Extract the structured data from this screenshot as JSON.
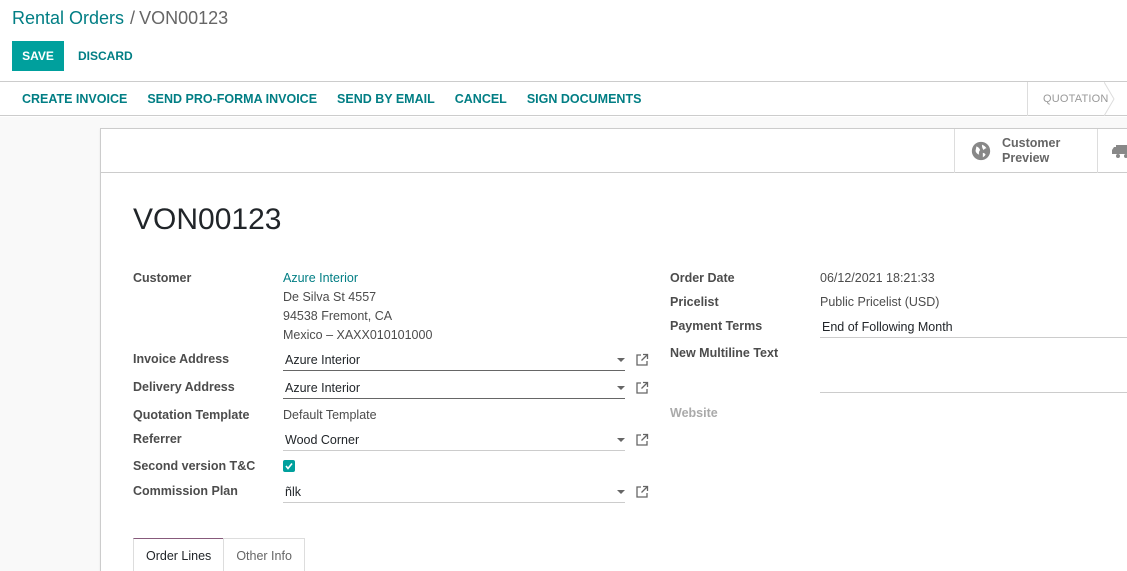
{
  "breadcrumb": {
    "parent": "Rental Orders",
    "separator": "/",
    "current": "VON00123"
  },
  "actions": {
    "save": "SAVE",
    "discard": "DISCARD"
  },
  "statusbar": {
    "buttons": [
      "CREATE INVOICE",
      "SEND PRO-FORMA INVOICE",
      "SEND BY EMAIL",
      "CANCEL",
      "SIGN DOCUMENTS"
    ],
    "stage": "QUOTATION"
  },
  "buttonbox": {
    "customer_preview": "Customer Preview",
    "customer_preview_icon": "globe-icon",
    "delivery_icon": "truck-icon"
  },
  "form": {
    "title": "VON00123",
    "left": {
      "customer_label": "Customer",
      "customer_name": "Azure Interior",
      "customer_address": [
        "De Silva St 4557",
        "94538 Fremont, CA",
        "Mexico – XAXX010101000"
      ],
      "invoice_address_label": "Invoice Address",
      "invoice_address_value": "Azure Interior",
      "delivery_address_label": "Delivery Address",
      "delivery_address_value": "Azure Interior",
      "quotation_template_label": "Quotation Template",
      "quotation_template_value": "Default Template",
      "referrer_label": "Referrer",
      "referrer_value": "Wood Corner",
      "second_version_label": "Second version T&C",
      "second_version_checked": true,
      "commission_plan_label": "Commission Plan",
      "commission_plan_value": "ñlk"
    },
    "right": {
      "order_date_label": "Order Date",
      "order_date_value": "06/12/2021 18:21:33",
      "pricelist_label": "Pricelist",
      "pricelist_value": "Public Pricelist (USD)",
      "payment_terms_label": "Payment Terms",
      "payment_terms_value": "End of Following Month",
      "multiline_label": "New Multiline Text",
      "multiline_value": "",
      "website_label": "Website"
    }
  },
  "tabs": [
    "Order Lines",
    "Other Info"
  ],
  "colors": {
    "accent": "#00a09d",
    "link": "#017e84",
    "tab_active": "#875a7b"
  }
}
